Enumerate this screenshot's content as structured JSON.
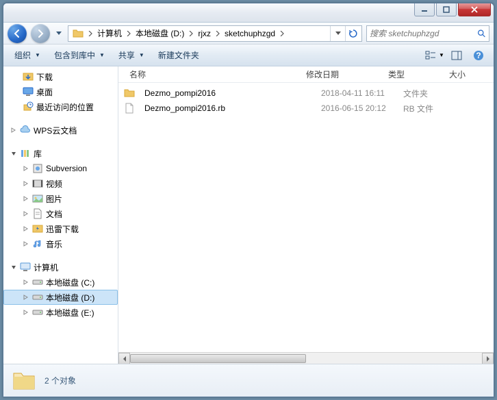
{
  "breadcrumb": {
    "items": [
      "计算机",
      "本地磁盘 (D:)",
      "rjxz",
      "sketchuphzgd"
    ]
  },
  "search": {
    "placeholder": "搜索 sketchuphzgd"
  },
  "toolbar": {
    "organize": "组织",
    "include": "包含到库中",
    "share": "共享",
    "newfolder": "新建文件夹"
  },
  "columns": {
    "name": "名称",
    "date": "修改日期",
    "type": "类型",
    "size": "大小"
  },
  "sidebar": {
    "favorites": {
      "downloads": "下载",
      "desktop": "桌面",
      "recent": "最近访问的位置"
    },
    "wps": "WPS云文档",
    "libraries": {
      "label": "库",
      "subversion": "Subversion",
      "videos": "视频",
      "pictures": "图片",
      "documents": "文档",
      "xunlei": "迅雷下载",
      "music": "音乐"
    },
    "computer": {
      "label": "计算机",
      "drive_c": "本地磁盘 (C:)",
      "drive_d": "本地磁盘 (D:)",
      "drive_e": "本地磁盘 (E:)"
    }
  },
  "files": [
    {
      "name": "Dezmo_pompi2016",
      "date": "2018-04-11 16:11",
      "type": "文件夹",
      "icon": "folder"
    },
    {
      "name": "Dezmo_pompi2016.rb",
      "date": "2016-06-15 20:12",
      "type": "RB 文件",
      "icon": "file"
    }
  ],
  "status": {
    "count": "2 个对象"
  },
  "icons": {
    "folder_color": "#f0c868",
    "folder_shadow": "#d8a838"
  }
}
